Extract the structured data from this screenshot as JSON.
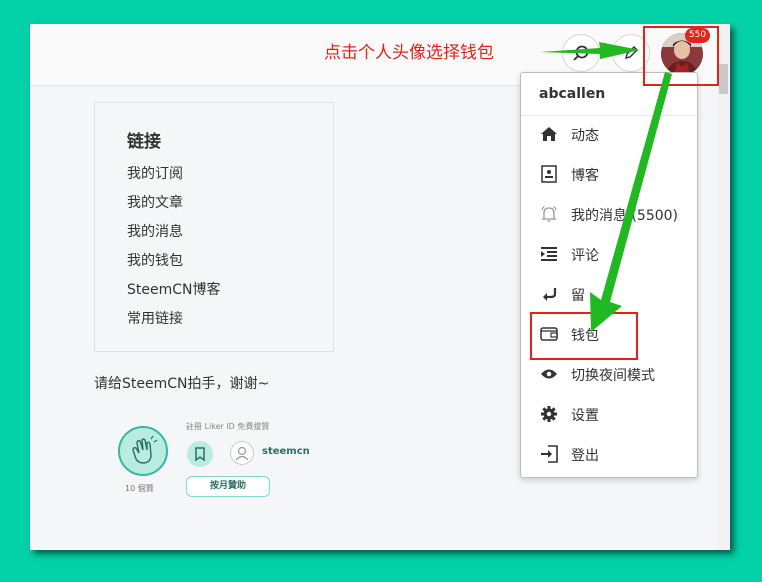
{
  "annotation": {
    "text": "点击个人头像选择钱包",
    "color": "#e2231a",
    "arrow_color": "#22b822"
  },
  "header": {
    "notification_count": "550"
  },
  "links_card": {
    "title": "链接",
    "items": [
      "我的订阅",
      "我的文章",
      "我的消息",
      "我的钱包",
      "SteemCN博客",
      "常用链接"
    ]
  },
  "thanks_text": "请给SteemCN拍手，谢谢~",
  "liker": {
    "count_label": "10 個贊",
    "register_label": "註冊 Liker ID 免費拔贊",
    "username": "steemcn",
    "monthly_button": "按月贊助"
  },
  "dropdown": {
    "username": "abcallen",
    "items": [
      {
        "label": "动态",
        "icon": "home-icon"
      },
      {
        "label": "博客",
        "icon": "blog-icon"
      },
      {
        "label": "我的消息 (5500)",
        "icon": "bell-icon"
      },
      {
        "label": "评论",
        "icon": "comments-icon"
      },
      {
        "label": "留",
        "icon": "reply-icon"
      },
      {
        "label": "钱包",
        "icon": "wallet-icon"
      },
      {
        "label": "切换夜间模式",
        "icon": "eye-icon"
      },
      {
        "label": "设置",
        "icon": "gear-icon"
      },
      {
        "label": "登出",
        "icon": "logout-icon"
      }
    ]
  },
  "colors": {
    "background": "#03d1a8",
    "accent": "#e2231a",
    "liker_green": "#35b89c"
  }
}
